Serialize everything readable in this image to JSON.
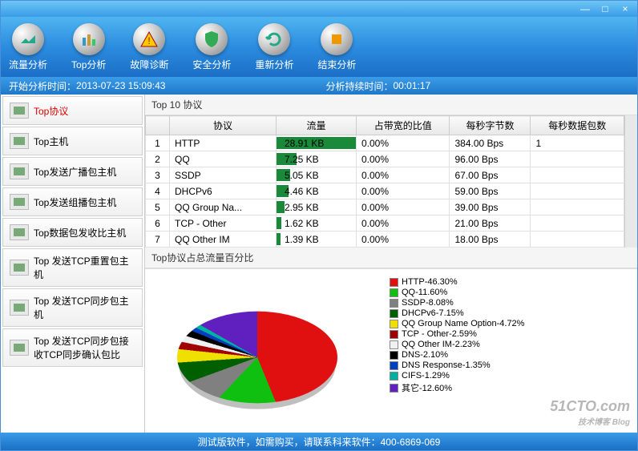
{
  "window": {
    "minimize": "—",
    "maximize": "□",
    "close": "×"
  },
  "toolbar": {
    "items": [
      {
        "label": "流量分析",
        "icon": "chart"
      },
      {
        "label": "Top分析",
        "icon": "bars"
      },
      {
        "label": "故障诊断",
        "icon": "warn"
      },
      {
        "label": "安全分析",
        "icon": "shield"
      },
      {
        "label": "重新分析",
        "icon": "refresh"
      },
      {
        "label": "结束分析",
        "icon": "stop"
      }
    ]
  },
  "status": {
    "start_label": "开始分析时间：",
    "start_value": "2013-07-23 15:09:43",
    "dur_label": "分析持续时间：",
    "dur_value": "00:01:17"
  },
  "sidebar": {
    "items": [
      {
        "label": "Top协议",
        "active": true
      },
      {
        "label": "Top主机"
      },
      {
        "label": "Top发送广播包主机"
      },
      {
        "label": "Top发送组播包主机"
      },
      {
        "label": "Top数据包发收比主机"
      },
      {
        "label": "Top 发送TCP重置包主机"
      },
      {
        "label": "Top 发送TCP同步包主机"
      },
      {
        "label": "Top 发送TCP同步包接收TCP同步确认包比"
      }
    ]
  },
  "table": {
    "title": "Top 10 协议",
    "headers": [
      "",
      "协议",
      "流量",
      "占带宽的比值",
      "每秒字节数",
      "每秒数据包数"
    ],
    "rows": [
      {
        "n": "1",
        "proto": "HTTP",
        "traffic": "28.91 KB",
        "bw": "0.00%",
        "bps": "384.00 Bps",
        "pps": "1",
        "bar": 100
      },
      {
        "n": "2",
        "proto": "QQ",
        "traffic": "7.25 KB",
        "bw": "0.00%",
        "bps": "96.00 Bps",
        "pps": "",
        "bar": 25
      },
      {
        "n": "3",
        "proto": "SSDP",
        "traffic": "5.05 KB",
        "bw": "0.00%",
        "bps": "67.00 Bps",
        "pps": "",
        "bar": 17
      },
      {
        "n": "4",
        "proto": "DHCPv6",
        "traffic": "4.46 KB",
        "bw": "0.00%",
        "bps": "59.00 Bps",
        "pps": "",
        "bar": 15
      },
      {
        "n": "5",
        "proto": "QQ Group Na...",
        "traffic": "2.95 KB",
        "bw": "0.00%",
        "bps": "39.00 Bps",
        "pps": "",
        "bar": 10
      },
      {
        "n": "6",
        "proto": "TCP - Other",
        "traffic": "1.62 KB",
        "bw": "0.00%",
        "bps": "21.00 Bps",
        "pps": "",
        "bar": 6
      },
      {
        "n": "7",
        "proto": "QQ Other IM",
        "traffic": "1.39 KB",
        "bw": "0.00%",
        "bps": "18.00 Bps",
        "pps": "",
        "bar": 5
      }
    ]
  },
  "chart_title": "Top协议占总流量百分比",
  "chart_data": {
    "type": "pie",
    "title": "Top协议占总流量百分比",
    "series": [
      {
        "name": "HTTP",
        "value": 46.3,
        "label": "HTTP-46.30%",
        "color": "#e01010"
      },
      {
        "name": "QQ",
        "value": 11.6,
        "label": "QQ-11.60%",
        "color": "#10c010"
      },
      {
        "name": "SSDP",
        "value": 8.08,
        "label": "SSDP-8.08%",
        "color": "#808080"
      },
      {
        "name": "DHCPv6",
        "value": 7.15,
        "label": "DHCPv6-7.15%",
        "color": "#006000"
      },
      {
        "name": "QQ Group Name Option",
        "value": 4.72,
        "label": "QQ Group Name Option-4.72%",
        "color": "#f0e000"
      },
      {
        "name": "TCP - Other",
        "value": 2.59,
        "label": "TCP - Other-2.59%",
        "color": "#a00000"
      },
      {
        "name": "QQ Other IM",
        "value": 2.23,
        "label": "QQ Other IM-2.23%",
        "color": "#f0f0f0"
      },
      {
        "name": "DNS",
        "value": 2.1,
        "label": "DNS-2.10%",
        "color": "#000000"
      },
      {
        "name": "DNS Response",
        "value": 1.35,
        "label": "DNS Response-1.35%",
        "color": "#0040c0"
      },
      {
        "name": "CIFS",
        "value": 1.29,
        "label": "CIFS-1.29%",
        "color": "#00b0a0"
      },
      {
        "name": "其它",
        "value": 12.6,
        "label": "其它-12.60%",
        "color": "#6020c0"
      }
    ]
  },
  "footer": {
    "text": "测试版软件，如需购买，请联系科来软件：400-6869-069"
  },
  "watermark": {
    "main": "51CTO.com",
    "sub": "技术博客 Blog"
  }
}
